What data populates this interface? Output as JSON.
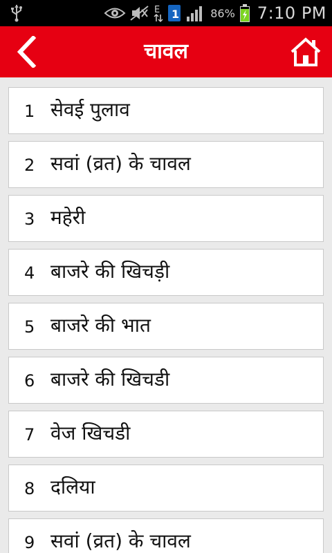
{
  "statusbar": {
    "icons": [
      "usb-icon",
      "eye-icon",
      "mute-icon",
      "data-e-icon",
      "sim-1-icon",
      "signal-icon",
      "battery-charging-icon"
    ],
    "battery_percent": "86%",
    "time": "7:10 PM"
  },
  "appbar": {
    "title": "चावल",
    "back_icon": "back-chevron-icon",
    "home_icon": "home-icon"
  },
  "list": {
    "items": [
      {
        "num": "1",
        "label": "सेवई पुलाव"
      },
      {
        "num": "2",
        "label": "सवां (व्रत) के चावल"
      },
      {
        "num": "3",
        "label": "महेरी"
      },
      {
        "num": "4",
        "label": "बाजरे की खिचड़ी"
      },
      {
        "num": "5",
        "label": "बाजरे की भात"
      },
      {
        "num": "6",
        "label": "बाजरे की खिचडी"
      },
      {
        "num": "7",
        "label": "वेज खिचडी"
      },
      {
        "num": "8",
        "label": "दलिया"
      },
      {
        "num": "9",
        "label": "सवां (व्रत) के चावल"
      }
    ]
  },
  "colors": {
    "appbar": "#e60012",
    "statusbar": "#000000",
    "list_background": "#eaeaea",
    "item_background": "#ffffff",
    "item_border": "#c8c8c8"
  }
}
